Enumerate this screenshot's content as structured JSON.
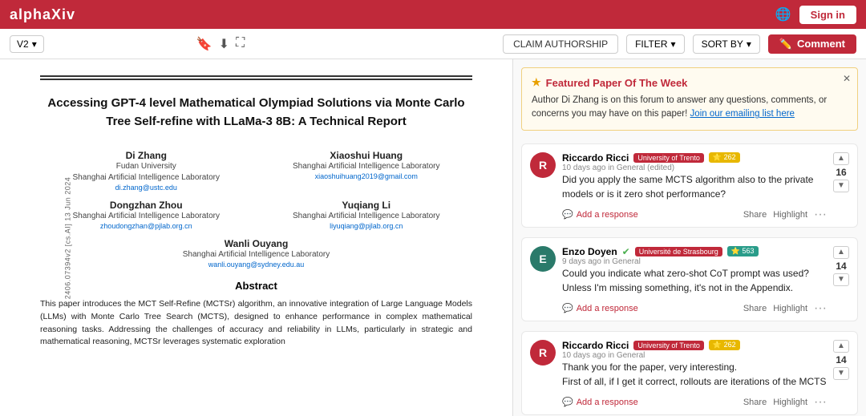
{
  "nav": {
    "logo": "alphaXiv",
    "sign_in": "Sign in"
  },
  "toolbar": {
    "version": "V2",
    "claim_authorship": "CLAIM AUTHORSHIP",
    "filter": "FILTER",
    "sort_by": "SORT BY",
    "comment": "Comment"
  },
  "paper": {
    "title": "Accessing GPT-4 level Mathematical Olympiad Solutions via Monte Carlo Tree Self-refine with LLaMa-3 8B: A Technical Report",
    "authors": [
      {
        "name": "Di Zhang",
        "institution": "Fudan University\nShanghai Artificial Intelligence Laboratory",
        "email": "di.zhang@ustc.edu"
      },
      {
        "name": "Xiaoshui Huang",
        "institution": "Shanghai Artificial Intelligence Laboratory",
        "email": "xiaoshuihuang2019@gmail.com"
      },
      {
        "name": "Dongzhan Zhou",
        "institution": "Shanghai Artificial Intelligence Laboratory",
        "email": "zhoudongzhan@pjlab.org.cn"
      },
      {
        "name": "Yuqiang Li",
        "institution": "Shanghai Artificial Intelligence Laboratory",
        "email": "liyuqiang@pjlab.org.cn"
      },
      {
        "name": "Wanli Ouyang",
        "institution": "Shanghai Artificial Intelligence Laboratory",
        "email": "wanli.ouyang@sydney.edu.au"
      }
    ],
    "abstract_heading": "Abstract",
    "abstract": "This paper introduces the MCT Self-Refine (MCTSr) algorithm, an innovative integration of Large Language Models (LLMs) with Monte Carlo Tree Search (MCTS), designed to enhance performance in complex mathematical reasoning tasks. Addressing the challenges of accuracy and reliability in LLMs, particularly in strategic and mathematical reasoning, MCTSr leverages systematic exploration"
  },
  "side_label": "cs.AI  13 Jun 2024",
  "arxiv_label": "2406.07394v2  [cs.AI]  13 Jun 2024",
  "featured": {
    "title": "Featured Paper Of The Week",
    "text": "Author Di Zhang is on this forum to answer any questions, comments, or concerns you may have on this paper!",
    "link_text": "Join our emailing list here"
  },
  "comments": [
    {
      "avatar_letter": "R",
      "avatar_color": "red",
      "author": "Riccardo Ricci",
      "university": "University of Trento",
      "score": "262",
      "time": "10 days ago in General (edited)",
      "body": "Did you apply the same MCTS algorithm also to the private models or is it zero shot performance?",
      "vote_count": "16",
      "add_response": "Add a response",
      "share": "Share",
      "highlight": "Highlight"
    },
    {
      "avatar_letter": "E",
      "avatar_color": "teal",
      "author": "Enzo Doyen",
      "university": "Université de Strasbourg",
      "score": "563",
      "score_color": "teal",
      "verified": true,
      "time": "9 days ago in General",
      "body": "Could you indicate what zero-shot CoT prompt was used? Unless I'm missing something, it's not in the Appendix.",
      "vote_count": "14",
      "add_response": "Add a response",
      "share": "Share",
      "highlight": "Highlight"
    },
    {
      "avatar_letter": "R",
      "avatar_color": "red",
      "author": "Riccardo Ricci",
      "university": "University of Trento",
      "score": "262",
      "time": "10 days ago in General",
      "body": "Thank you for the paper, very interesting.\nFirst of all, if I get it correct, rollouts are iterations of the MCTS",
      "vote_count": "14",
      "add_response": "Add a response",
      "share": "Share",
      "highlight": "Highlight"
    }
  ]
}
